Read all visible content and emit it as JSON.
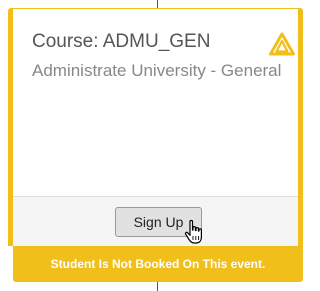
{
  "card": {
    "title": "Course: ADMU_GEN",
    "subtitle": "Administrate University - General",
    "warning_icon": "warning-triangle-icon",
    "accent_color": "#f0bf1a",
    "signup_label": "Sign Up",
    "status_message": "Student Is Not Booked On This event."
  },
  "cursor": "hand-pointer-icon"
}
